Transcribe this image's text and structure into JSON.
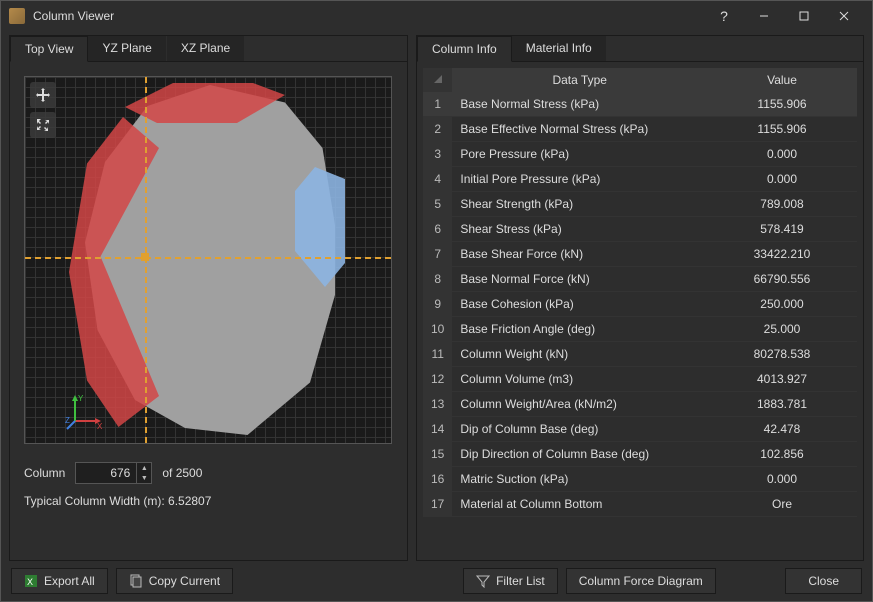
{
  "window": {
    "title": "Column Viewer"
  },
  "left": {
    "tabs": [
      "Top View",
      "YZ Plane",
      "XZ Plane"
    ],
    "active_tab": 0,
    "column_label": "Column",
    "column_value": "676",
    "column_total_prefix": "of ",
    "column_total": "2500",
    "typical_width_label": "Typical Column Width (m): ",
    "typical_width_value": "6.52807"
  },
  "right": {
    "tabs": [
      "Column Info",
      "Material Info"
    ],
    "active_tab": 0,
    "headers": {
      "type": "Data Type",
      "value": "Value"
    },
    "rows": [
      {
        "n": "1",
        "type": "Base Normal Stress (kPa)",
        "value": "1155.906"
      },
      {
        "n": "2",
        "type": "Base Effective Normal Stress (kPa)",
        "value": "1155.906"
      },
      {
        "n": "3",
        "type": "Pore Pressure (kPa)",
        "value": "0.000"
      },
      {
        "n": "4",
        "type": "Initial Pore Pressure (kPa)",
        "value": "0.000"
      },
      {
        "n": "5",
        "type": "Shear Strength (kPa)",
        "value": "789.008"
      },
      {
        "n": "6",
        "type": "Shear Stress (kPa)",
        "value": "578.419"
      },
      {
        "n": "7",
        "type": "Base Shear Force (kN)",
        "value": "33422.210"
      },
      {
        "n": "8",
        "type": "Base Normal Force (kN)",
        "value": "66790.556"
      },
      {
        "n": "9",
        "type": "Base Cohesion (kPa)",
        "value": "250.000"
      },
      {
        "n": "10",
        "type": "Base Friction Angle (deg)",
        "value": "25.000"
      },
      {
        "n": "11",
        "type": "Column Weight (kN)",
        "value": "80278.538"
      },
      {
        "n": "12",
        "type": "Column Volume (m3)",
        "value": "4013.927"
      },
      {
        "n": "13",
        "type": "Column Weight/Area (kN/m2)",
        "value": "1883.781"
      },
      {
        "n": "14",
        "type": "Dip of Column Base (deg)",
        "value": "42.478"
      },
      {
        "n": "15",
        "type": "Dip Direction of Column Base (deg)",
        "value": "102.856"
      },
      {
        "n": "16",
        "type": "Matric Suction (kPa)",
        "value": "0.000"
      },
      {
        "n": "17",
        "type": "Material at Column Bottom",
        "value": "Ore"
      }
    ],
    "selected_row": 0
  },
  "footer": {
    "export_all": "Export All",
    "copy_current": "Copy Current",
    "filter_list": "Filter List",
    "force_diagram": "Column Force Diagram",
    "close": "Close"
  }
}
